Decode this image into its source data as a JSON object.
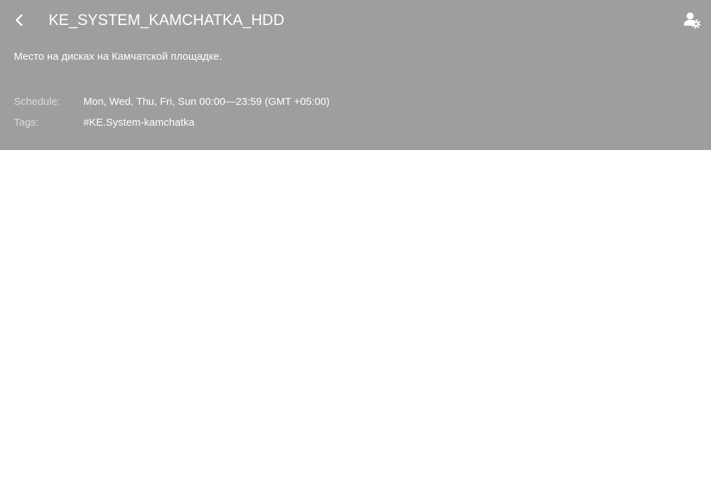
{
  "header": {
    "title": "KE_SYSTEM_KAMCHATKA_HDD",
    "description": "Место на дисках на Камчатской площадке.",
    "background_color": "#9e9e9e",
    "back_icon": "chevron-left-icon",
    "settings_icon": "user-gear-icon"
  },
  "meta": {
    "schedule_label": "Schedule:",
    "schedule_value": "Mon, Wed, Thu, Fri, Sun 00:00—23:59 (GMT +05:00)",
    "tags_label": "Tags:",
    "tags_value": "#KE.System-kamchatka"
  }
}
